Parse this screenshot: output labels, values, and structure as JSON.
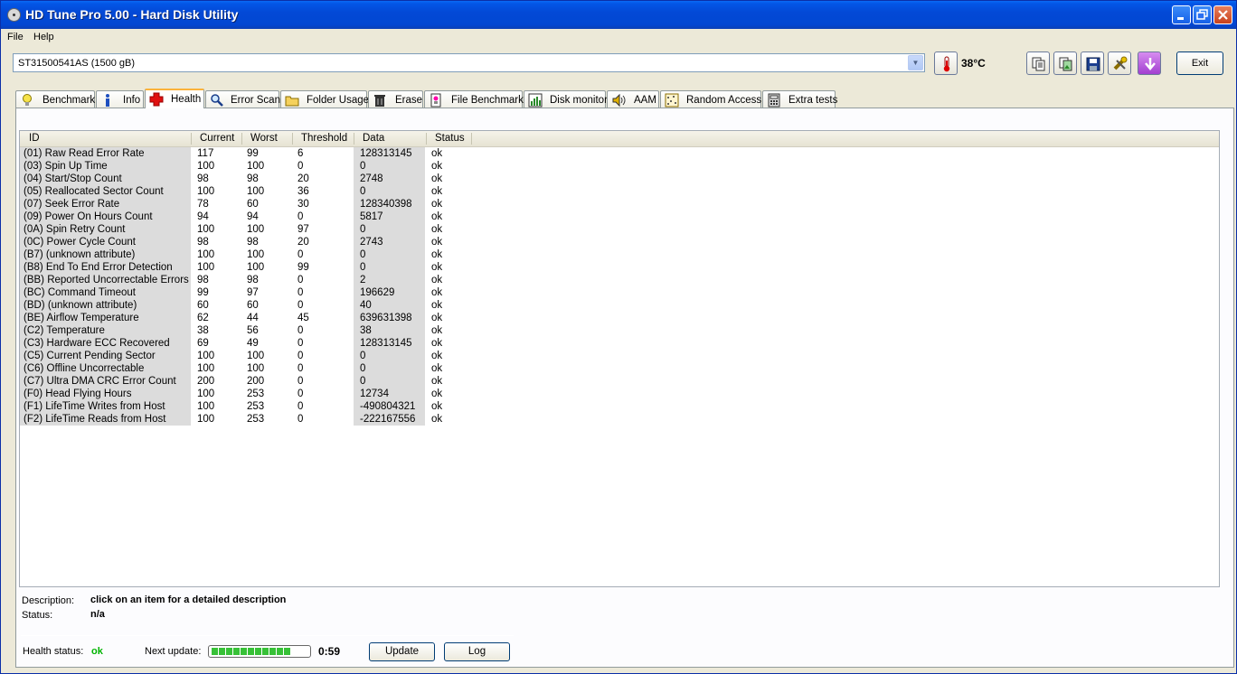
{
  "window": {
    "title": "HD Tune Pro 5.00 - Hard Disk Utility"
  },
  "menu": [
    {
      "label": "File"
    },
    {
      "label": "Help"
    }
  ],
  "drive": {
    "selected": "ST31500541AS (1500 gB)"
  },
  "temperature": "38°C",
  "toolbar": {
    "exit_label": "Exit"
  },
  "tabs": [
    {
      "label": "Benchmark",
      "icon": "lightbulb-icon"
    },
    {
      "label": "Info",
      "icon": "info-icon"
    },
    {
      "label": "Health",
      "icon": "red-cross-icon",
      "active": true
    },
    {
      "label": "Error Scan",
      "icon": "magnifier-icon"
    },
    {
      "label": "Folder Usage",
      "icon": "folder-icon"
    },
    {
      "label": "Erase",
      "icon": "trash-icon"
    },
    {
      "label": "File Benchmark",
      "icon": "file-benchmark-icon"
    },
    {
      "label": "Disk monitor",
      "icon": "chart-icon"
    },
    {
      "label": "AAM",
      "icon": "speaker-icon"
    },
    {
      "label": "Random Access",
      "icon": "random-access-icon"
    },
    {
      "label": "Extra tests",
      "icon": "calculator-icon"
    }
  ],
  "table": {
    "columns": [
      "ID",
      "Current",
      "Worst",
      "Threshold",
      "Data",
      "Status"
    ],
    "rows": [
      [
        "(01) Raw Read Error Rate",
        "117",
        "99",
        "6",
        "128313145",
        "ok"
      ],
      [
        "(03) Spin Up Time",
        "100",
        "100",
        "0",
        "0",
        "ok"
      ],
      [
        "(04) Start/Stop Count",
        "98",
        "98",
        "20",
        "2748",
        "ok"
      ],
      [
        "(05) Reallocated Sector Count",
        "100",
        "100",
        "36",
        "0",
        "ok"
      ],
      [
        "(07) Seek Error Rate",
        "78",
        "60",
        "30",
        "128340398",
        "ok"
      ],
      [
        "(09) Power On Hours Count",
        "94",
        "94",
        "0",
        "5817",
        "ok"
      ],
      [
        "(0A) Spin Retry Count",
        "100",
        "100",
        "97",
        "0",
        "ok"
      ],
      [
        "(0C) Power Cycle Count",
        "98",
        "98",
        "20",
        "2743",
        "ok"
      ],
      [
        "(B7) (unknown attribute)",
        "100",
        "100",
        "0",
        "0",
        "ok"
      ],
      [
        "(B8) End To End Error Detection",
        "100",
        "100",
        "99",
        "0",
        "ok"
      ],
      [
        "(BB) Reported Uncorrectable Errors",
        "98",
        "98",
        "0",
        "2",
        "ok"
      ],
      [
        "(BC) Command Timeout",
        "99",
        "97",
        "0",
        "196629",
        "ok"
      ],
      [
        "(BD) (unknown attribute)",
        "60",
        "60",
        "0",
        "40",
        "ok"
      ],
      [
        "(BE) Airflow Temperature",
        "62",
        "44",
        "45",
        "639631398",
        "ok"
      ],
      [
        "(C2) Temperature",
        "38",
        "56",
        "0",
        "38",
        "ok"
      ],
      [
        "(C3) Hardware ECC Recovered",
        "69",
        "49",
        "0",
        "128313145",
        "ok"
      ],
      [
        "(C5) Current Pending Sector",
        "100",
        "100",
        "0",
        "0",
        "ok"
      ],
      [
        "(C6) Offline Uncorrectable",
        "100",
        "100",
        "0",
        "0",
        "ok"
      ],
      [
        "(C7) Ultra DMA CRC Error Count",
        "200",
        "200",
        "0",
        "0",
        "ok"
      ],
      [
        "(F0) Head Flying Hours",
        "100",
        "253",
        "0",
        "12734",
        "ok"
      ],
      [
        "(F1) LifeTime Writes from Host",
        "100",
        "253",
        "0",
        "-490804321",
        "ok"
      ],
      [
        "(F2) LifeTime Reads from Host",
        "100",
        "253",
        "0",
        "-222167556",
        "ok"
      ]
    ]
  },
  "description": {
    "label": "Description:",
    "value": "click on an item for a detailed description"
  },
  "status": {
    "label": "Status:",
    "value": "n/a"
  },
  "health": {
    "label": "Health status:",
    "value": "ok",
    "color": "#00b400"
  },
  "next_update": {
    "label": "Next update:",
    "time": "0:59",
    "progress": 1.0
  },
  "buttons": {
    "update": "Update",
    "log": "Log"
  }
}
